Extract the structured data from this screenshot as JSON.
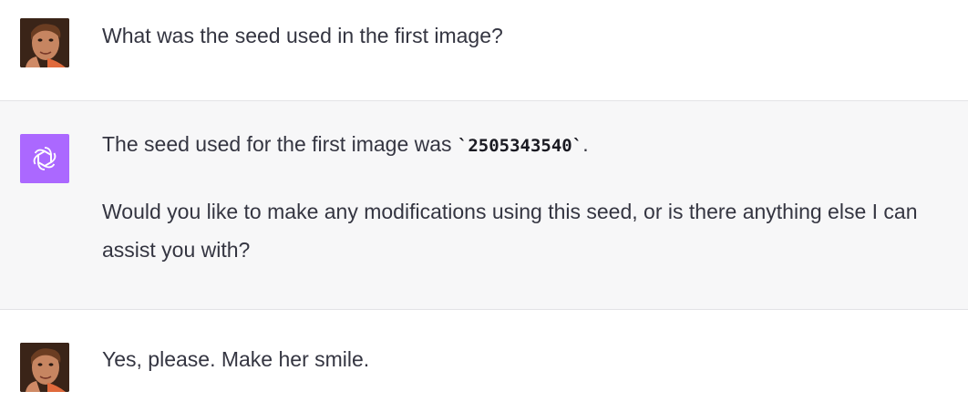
{
  "messages": [
    {
      "role": "user",
      "avatar_icon": "user-avatar-photo",
      "text": "What was the seed used in the first image?"
    },
    {
      "role": "assistant",
      "avatar_icon": "openai-logo-icon",
      "avatar_color": "#ab68ff",
      "text_before_code": "The seed used for the first image was ",
      "code": "`2505343540`",
      "text_after_code": ".",
      "paragraph2": "Would you like to make any modifications using this seed, or is there anything else I can assist you with?"
    },
    {
      "role": "user",
      "avatar_icon": "user-avatar-photo",
      "text": "Yes, please. Make her smile."
    }
  ]
}
